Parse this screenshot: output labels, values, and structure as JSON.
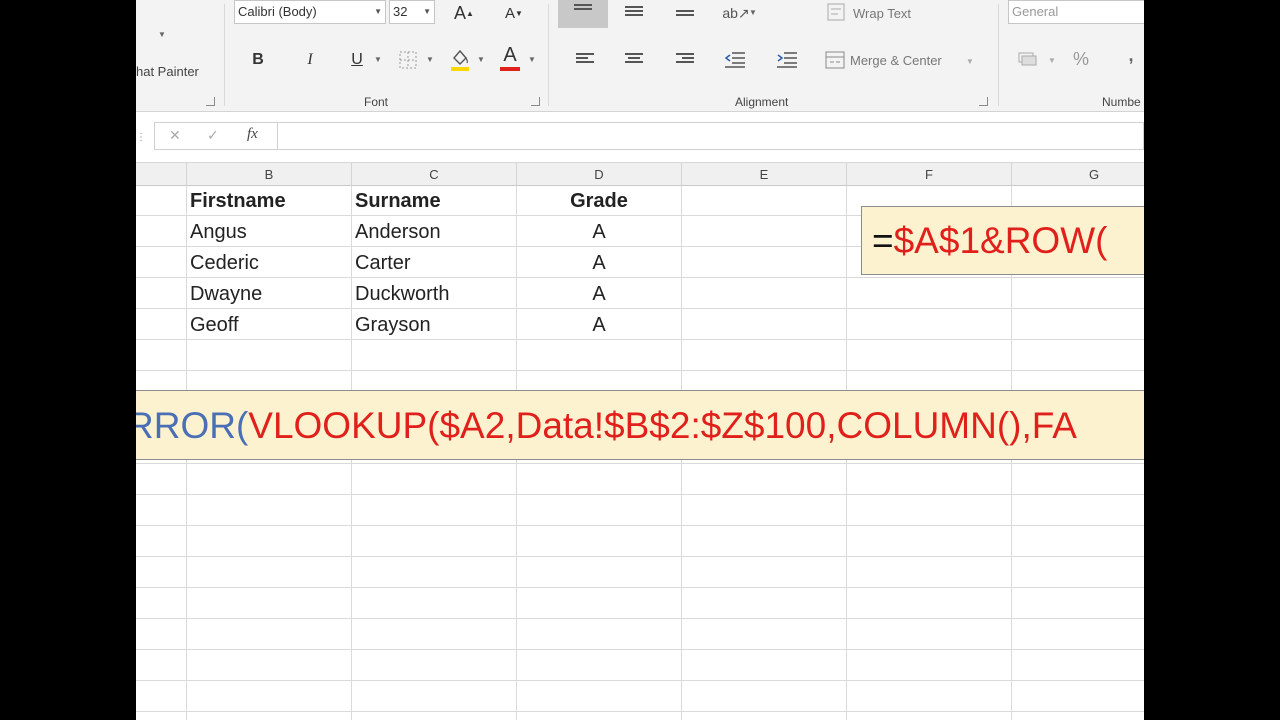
{
  "ribbon": {
    "clipboard": {
      "format_painter_label": "hat Painter"
    },
    "font": {
      "group_label": "Font",
      "font_name": "Calibri (Body)",
      "font_size": "32",
      "grow_label": "A",
      "shrink_label": "A",
      "bold_label": "B",
      "italic_label": "I",
      "underline_label": "U",
      "font_color_label": "A",
      "font_color": "#e0201b",
      "fill_color": "#ffd700"
    },
    "alignment": {
      "group_label": "Alignment",
      "wrap_text_label": "Wrap Text",
      "merge_center_label": "Merge & Center"
    },
    "number": {
      "group_label": "Numbe",
      "format_value": "General",
      "percent_label": "%",
      "comma_label": ","
    }
  },
  "formula_bar": {
    "cancel_icon": "✕",
    "enter_icon": "✓",
    "fx_label": "fx",
    "value": ""
  },
  "columns": [
    "B",
    "C",
    "D",
    "E",
    "F",
    "G"
  ],
  "table": {
    "headers": [
      "Firstname",
      "Surname",
      "Grade"
    ],
    "rows": [
      [
        "Angus",
        "Anderson",
        "A"
      ],
      [
        "Cederic",
        "Carter",
        "A"
      ],
      [
        "Dwayne",
        "Duckworth",
        "A"
      ],
      [
        "Geoff",
        "Grayson",
        "A"
      ]
    ]
  },
  "callouts": {
    "row_formula": {
      "eq": "=",
      "body": "$A$1&ROW("
    },
    "lookup_formula": {
      "prefix": "RROR(",
      "body": "VLOOKUP($A2,Data!$B$2:$Z$100,COLUMN(),FA"
    }
  }
}
